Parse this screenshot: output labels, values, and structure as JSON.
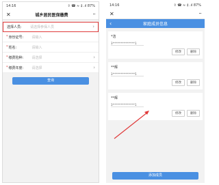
{
  "left": {
    "status": {
      "time": "14:16",
      "right": "⇪ ☎ ≈ ‡ .ıl 87%"
    },
    "title": "城乡居民医保缴费",
    "close_icon": "✕",
    "more_icon": "···",
    "fields": [
      {
        "required": false,
        "label": "选择人员:",
        "placeholder": "请选择参保人员",
        "arrow": true
      },
      {
        "required": true,
        "label": "身份证号:",
        "placeholder": "请输入",
        "arrow": false
      },
      {
        "required": true,
        "label": "姓名:",
        "placeholder": "请输入",
        "arrow": false
      },
      {
        "required": true,
        "label": "缴费险种:",
        "placeholder": "请选择",
        "arrow": true
      },
      {
        "required": true,
        "label": "缴费年度:",
        "placeholder": "请选择",
        "arrow": true
      }
    ],
    "query_button": "查询"
  },
  "right": {
    "status": {
      "time": "14:16",
      "right": "⇪ ☎ ≈ ‡ .ıl 87%"
    },
    "close_icon": "✕",
    "more_icon": "···",
    "nav_title": "家庭成员信息",
    "back_icon": "‹",
    "members": [
      {
        "name": "*洁",
        "id": "3**************1"
      },
      {
        "name": "**辉",
        "id": "3**************5"
      },
      {
        "name": "**辉",
        "id": "3**************1"
      }
    ],
    "edit_label": "修改",
    "delete_label": "删除",
    "add_button": "添加成员"
  },
  "colors": {
    "primary": "#4a90e2",
    "highlight": "#e03a3a"
  }
}
